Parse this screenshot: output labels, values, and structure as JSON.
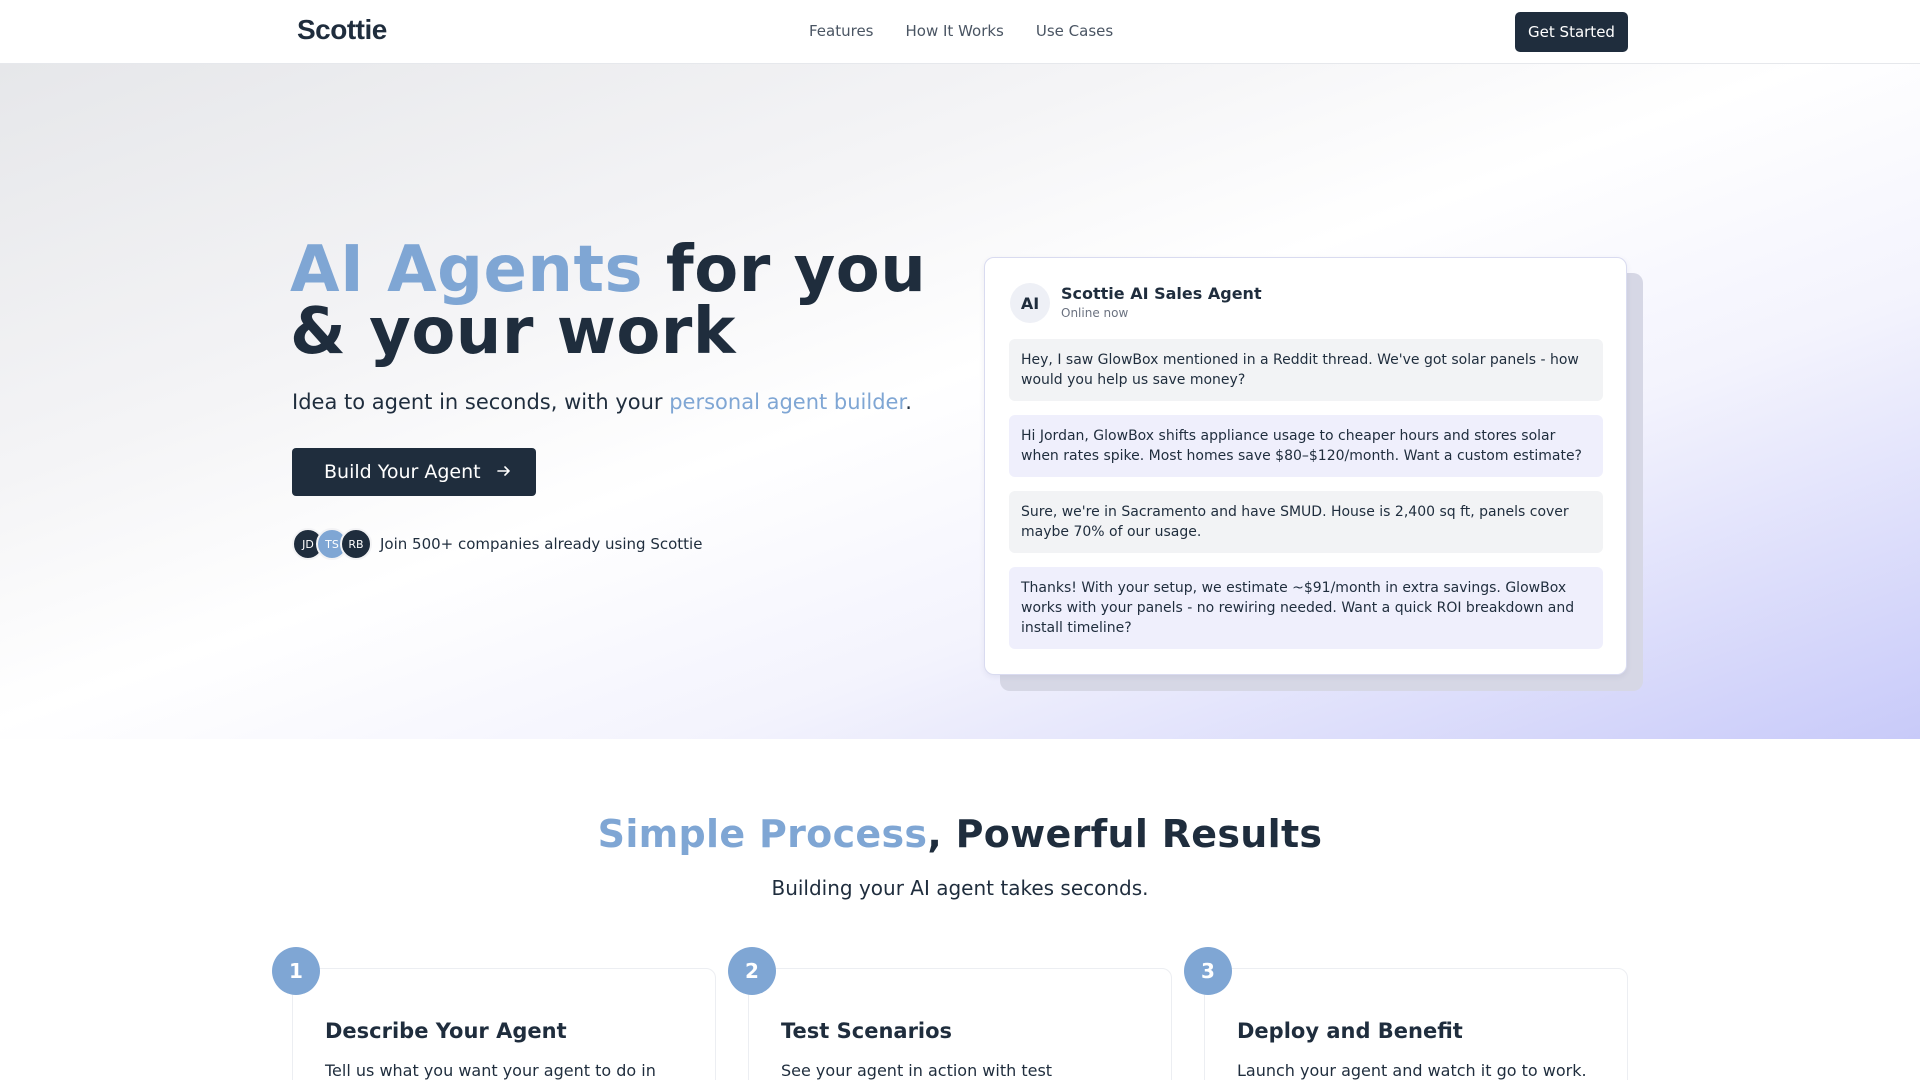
{
  "nav": {
    "logo": "Scottie",
    "links": [
      "Features",
      "How It Works",
      "Use Cases"
    ],
    "cta": "Get Started"
  },
  "hero": {
    "title_accent": "AI Agents",
    "title_rest_line1": " for you",
    "title_line2": "& your work",
    "subtitle_prefix": "Idea to agent in seconds, with your ",
    "subtitle_link": "personal agent builder",
    "subtitle_suffix": ".",
    "button_label": "Build Your Agent",
    "button_icon": "arrow-right-icon",
    "avatars": [
      "JD",
      "TS",
      "RB"
    ],
    "social_text": "Join 500+ companies already using Scottie"
  },
  "chat": {
    "avatar_label": "AI",
    "agent_name": "Scottie AI Sales Agent",
    "status": "Online now",
    "messages": [
      {
        "role": "user",
        "text": "Hey, I saw GlowBox mentioned in a Reddit thread. We've got solar panels - how would you help us save money?"
      },
      {
        "role": "agent",
        "text": "Hi Jordan, GlowBox shifts appliance usage to cheaper hours and stores solar when rates spike. Most homes save $80–$120/month. Want a custom estimate?"
      },
      {
        "role": "user",
        "text": "Sure, we're in Sacramento and have SMUD. House is 2,400 sq ft, panels cover maybe 70% of our usage."
      },
      {
        "role": "agent",
        "text": "Thanks! With your setup, we estimate ~$91/month in extra savings. GlowBox works with your panels - no rewiring needed. Want a quick ROI breakdown and install timeline?"
      }
    ]
  },
  "process": {
    "title_accent": "Simple Process",
    "title_rest": ", Powerful Results",
    "subtitle": "Building your AI agent takes seconds.",
    "steps": [
      {
        "number": "1",
        "title": "Describe Your Agent",
        "desc": "Tell us what you want your agent to do in"
      },
      {
        "number": "2",
        "title": "Test Scenarios",
        "desc": "See your agent in action with test"
      },
      {
        "number": "3",
        "title": "Deploy and Benefit",
        "desc": "Launch your agent and watch it go to work."
      }
    ]
  },
  "colors": {
    "primary": "#1f2d3d",
    "accent": "#7fa6d4",
    "agent_bubble": "#efeffc",
    "user_bubble": "#f2f3f5"
  }
}
